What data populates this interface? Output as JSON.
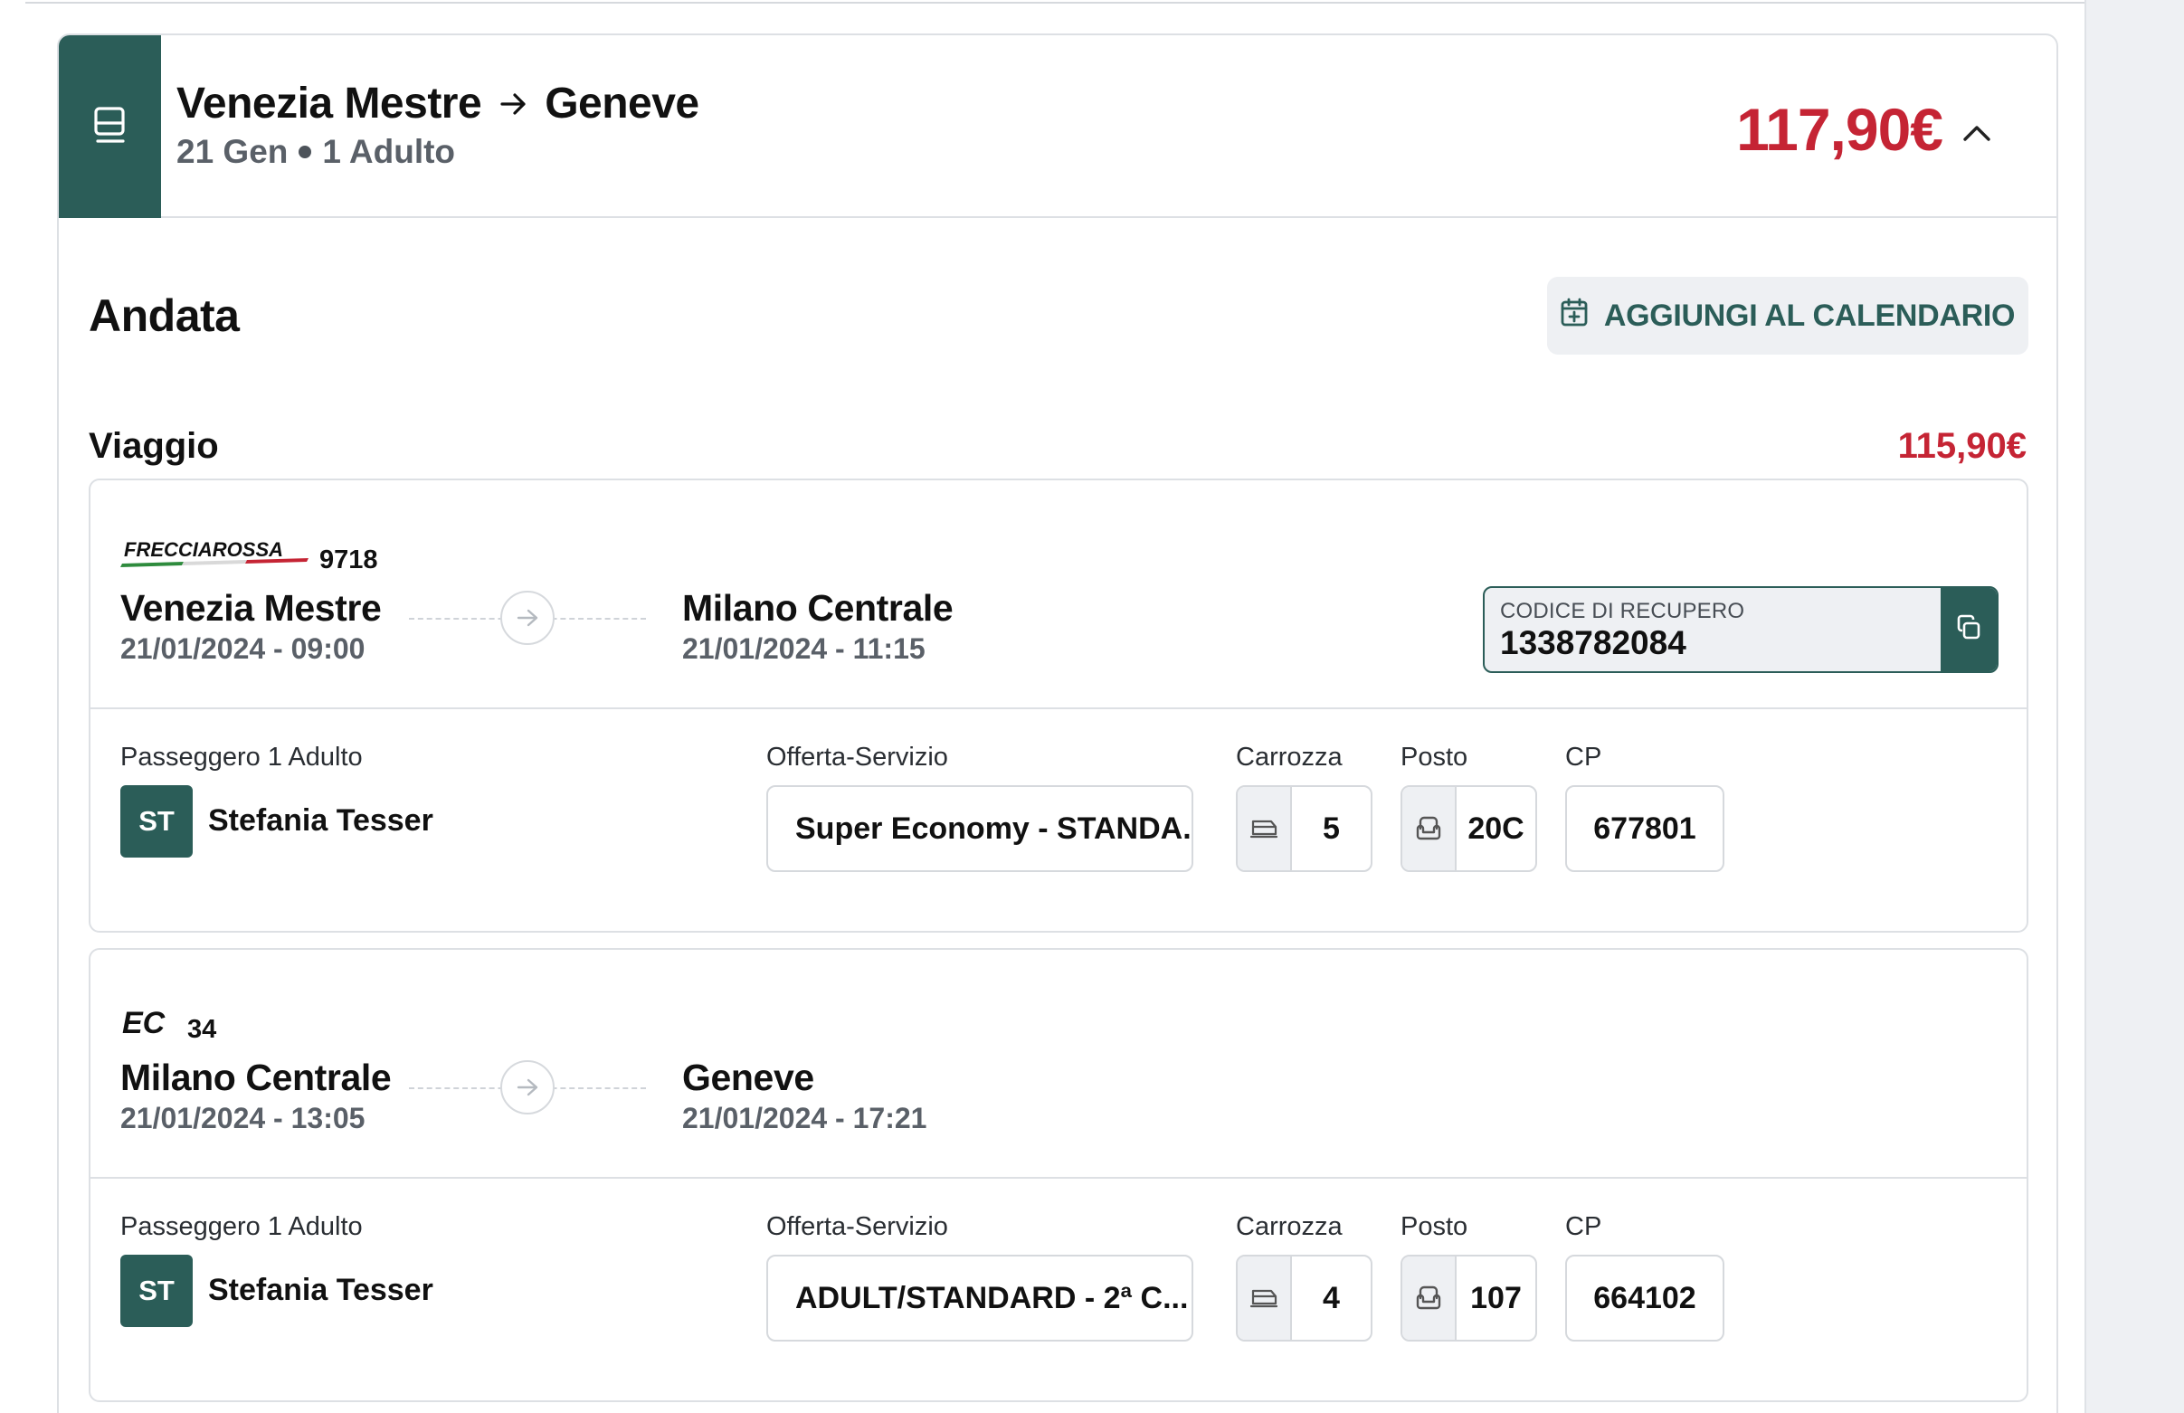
{
  "header": {
    "origin": "Venezia Mestre",
    "destination": "Geneve",
    "date": "21 Gen",
    "passengers": "1 Adulto",
    "total_price": "117,90€"
  },
  "section": {
    "title": "Andata",
    "calendar_button": "AGGIUNGI AL CALENDARIO"
  },
  "viaggio": {
    "label": "Viaggio",
    "price": "115,90€"
  },
  "labels": {
    "passenger": "Passeggero 1 Adulto",
    "offer": "Offerta-Servizio",
    "coach": "Carrozza",
    "seat": "Posto",
    "cp": "CP"
  },
  "legs": [
    {
      "brand": "FRECCIAROSSA",
      "train_number": "9718",
      "from_station": "Venezia Mestre",
      "from_time": "21/01/2024 - 09:00",
      "to_station": "Milano Centrale",
      "to_time": "21/01/2024 - 11:15",
      "recovery_code_label": "CODICE DI RECUPERO",
      "recovery_code": "1338782084",
      "passenger_initials": "ST",
      "passenger_name": "Stefania Tesser",
      "offer": "Super Economy - STANDA...",
      "coach": "5",
      "seat": "20C",
      "cp": "677801"
    },
    {
      "brand": "EC",
      "train_number": "34",
      "from_station": "Milano Centrale",
      "from_time": "21/01/2024 - 13:05",
      "to_station": "Geneve",
      "to_time": "21/01/2024 - 17:21",
      "passenger_initials": "ST",
      "passenger_name": "Stefania Tesser",
      "offer": "ADULT/STANDARD - 2ª C...",
      "coach": "4",
      "seat": "107",
      "cp": "664102"
    }
  ],
  "colors": {
    "brand_green": "#2b5d58",
    "price_red": "#c52434"
  },
  "icons": [
    "train-icon",
    "arrow-right-icon",
    "chevron-up-icon",
    "calendar-add-icon",
    "copy-icon",
    "coach-icon",
    "seat-icon"
  ]
}
